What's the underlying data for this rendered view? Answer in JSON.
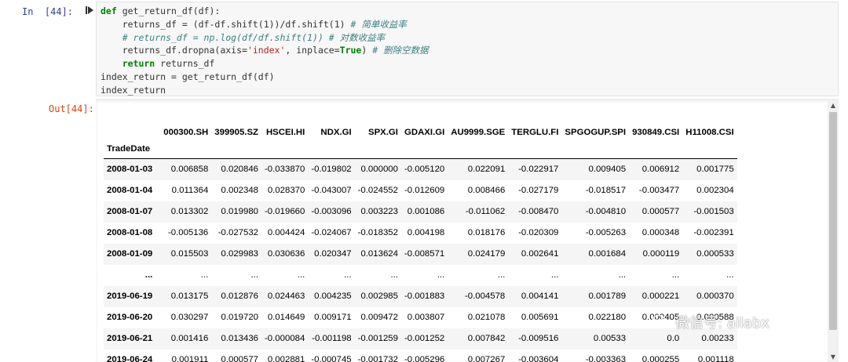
{
  "input_prompt": "In  [44]:",
  "output_prompt": "Out[44]:",
  "code": {
    "l1_kw": "def",
    "l1_rest": " get_return_df(df):",
    "l2_code": "    returns_df = (df-df.shift(1))/df.shift(1) ",
    "l2_comment": "# 简单收益率",
    "l3_comment": "    # returns_df = np.log(df/df.shift(1)) # 对数收益率",
    "l4_pre": "    returns_df.dropna(axis=",
    "l4_str": "'index'",
    "l4_mid": ", inplace=",
    "l4_true": "True",
    "l4_post": ") ",
    "l4_comment": "# 删除空数据",
    "l5_kw": "    return",
    "l5_rest": " returns_df",
    "l6": "index_return = get_return_df(df)",
    "l7": "index_return"
  },
  "table": {
    "index_name": "TradeDate",
    "columns": [
      "000300.SH",
      "399905.SZ",
      "HSCEI.HI",
      "NDX.GI",
      "SPX.GI",
      "GDAXI.GI",
      "AU9999.SGE",
      "TERGLU.FI",
      "SPGOGUP.SPI",
      "930849.CSI",
      "H11008.CSI"
    ],
    "rows": [
      {
        "date": "2008-01-03",
        "values": [
          "0.006858",
          "0.020846",
          "-0.033870",
          "-0.019802",
          "0.000000",
          "-0.005120",
          "0.022091",
          "-0.022917",
          "0.009405",
          "0.006912",
          "0.001775"
        ]
      },
      {
        "date": "2008-01-04",
        "values": [
          "0.011364",
          "0.002348",
          "0.028370",
          "-0.043007",
          "-0.024552",
          "-0.012609",
          "0.008466",
          "-0.027179",
          "-0.018517",
          "-0.003477",
          "0.002304"
        ]
      },
      {
        "date": "2008-01-07",
        "values": [
          "0.013302",
          "0.019980",
          "-0.019660",
          "-0.003096",
          "0.003223",
          "0.001086",
          "-0.011062",
          "-0.008470",
          "-0.004810",
          "0.000577",
          "-0.001503"
        ]
      },
      {
        "date": "2008-01-08",
        "values": [
          "-0.005136",
          "-0.027532",
          "0.004424",
          "-0.024067",
          "-0.018352",
          "0.004198",
          "0.018176",
          "-0.020309",
          "-0.005263",
          "0.000348",
          "-0.002391"
        ]
      },
      {
        "date": "2008-01-09",
        "values": [
          "0.015503",
          "0.029983",
          "0.030636",
          "0.020347",
          "0.013624",
          "-0.008571",
          "0.024179",
          "0.002641",
          "0.001684",
          "0.000119",
          "0.000533"
        ]
      },
      {
        "date": "...",
        "values": [
          "...",
          "...",
          "...",
          "...",
          "...",
          "...",
          "...",
          "...",
          "...",
          "...",
          "..."
        ]
      },
      {
        "date": "2019-06-19",
        "values": [
          "0.013175",
          "0.012876",
          "0.024463",
          "0.004235",
          "0.002985",
          "-0.001883",
          "-0.004578",
          "0.004141",
          "0.001789",
          "0.000221",
          "0.000370"
        ]
      },
      {
        "date": "2019-06-20",
        "values": [
          "0.030297",
          "0.019720",
          "0.014649",
          "0.009171",
          "0.009472",
          "0.003807",
          "0.021078",
          "0.005691",
          "0.022180",
          "0.000405",
          "0.000588"
        ]
      },
      {
        "date": "2019-06-21",
        "values": [
          "0.001416",
          "0.013436",
          "-0.000084",
          "-0.001198",
          "-0.001259",
          "-0.001252",
          "0.007842",
          "-0.009516",
          "0.00533",
          "0.0",
          "0.00233"
        ]
      },
      {
        "date": "2019-06-24",
        "values": [
          "0.001911",
          "0.000577",
          "0.002881",
          "-0.000745",
          "-0.001732",
          "-0.005296",
          "0.007267",
          "-0.003604",
          "-0.003363",
          "0.000255",
          "0.001118"
        ]
      }
    ]
  },
  "watermark": "微信号: ailabx",
  "colors": {
    "keyword": "#008000",
    "comment": "#408080",
    "string": "#ba2121",
    "in_prompt": "#303f9f",
    "out_prompt": "#d84315"
  }
}
